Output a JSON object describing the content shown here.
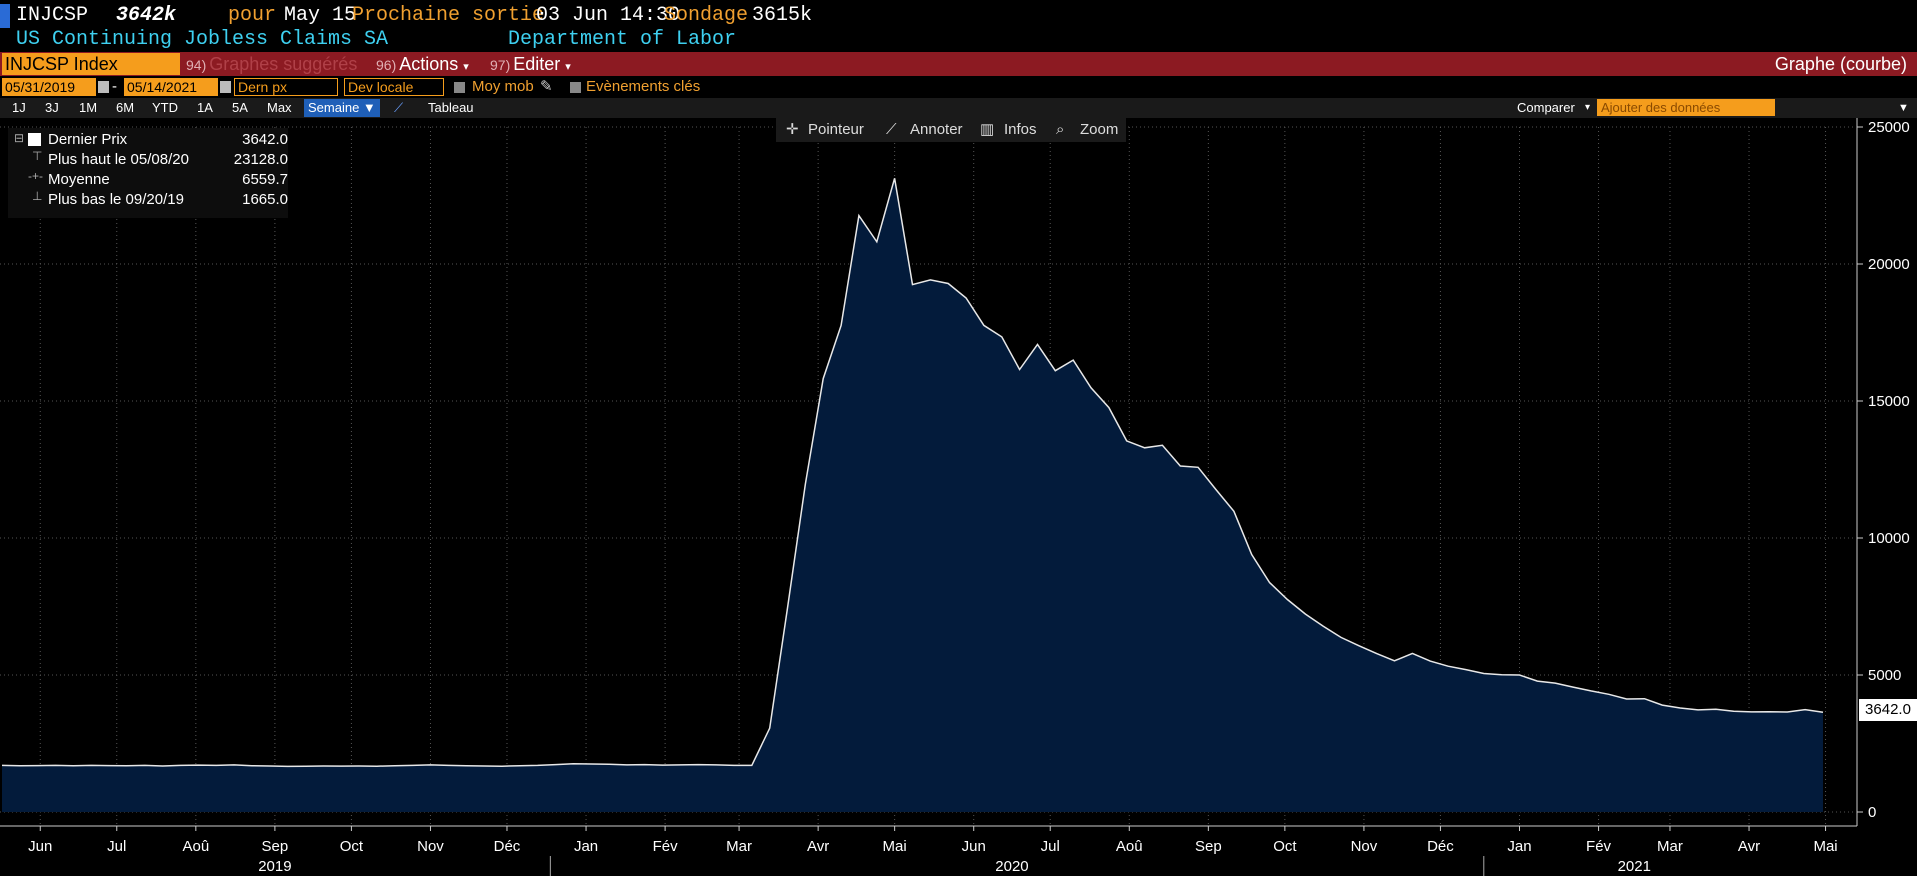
{
  "header": {
    "ticker": "INJCSP",
    "last_value": "3642k",
    "period_label": "pour",
    "period": "May 15",
    "next_release_label": "Prochaine sortie",
    "next_release": "03 Jun 14:30",
    "survey_label": "Sondage",
    "survey": "3615k",
    "description": "US Continuing Jobless Claims SA",
    "source": "Department of Labor"
  },
  "toolbar": {
    "security": "INJCSP Index",
    "suggested": {
      "num": "94)",
      "label": "Graphes suggérés"
    },
    "actions": {
      "num": "96)",
      "label": "Actions"
    },
    "edit": {
      "num": "97)",
      "label": "Editer"
    },
    "graph_type": "Graphe (courbe)"
  },
  "controls": {
    "start_date": "05/31/2019",
    "dash": "-",
    "end_date": "05/14/2021",
    "price_field": "Dern px",
    "currency": "Dev locale",
    "moving_avg": "Moy mob",
    "key_events": "Evènements clés",
    "periods": [
      "1J",
      "3J",
      "1M",
      "6M",
      "YTD",
      "1A",
      "5A",
      "Max"
    ],
    "frequency": "Semaine ▼",
    "table": "Tableau",
    "compare": "Comparer",
    "add_data_placeholder": "Ajouter des données"
  },
  "chart_tools": {
    "pointer": "Pointeur",
    "annotate": "Annoter",
    "info": "Infos",
    "zoom": "Zoom"
  },
  "legend": {
    "last": {
      "label": "Dernier Prix",
      "value": "3642.0"
    },
    "high": {
      "label": "Plus haut le 05/08/20",
      "value": "23128.0"
    },
    "avg": {
      "label": "Moyenne",
      "value": "6559.7"
    },
    "low": {
      "label": "Plus bas le 09/20/19",
      "value": "1665.0"
    }
  },
  "colors": {
    "fill": "#031b3b",
    "line": "#e8e8e8",
    "accent": "#f59d1c",
    "bar": "#8c1a22"
  },
  "chart_data": {
    "type": "area",
    "title": "",
    "xlabel": "",
    "ylabel": "",
    "ylim": [
      0,
      25000
    ],
    "yticks": [
      0,
      5000,
      10000,
      15000,
      20000,
      25000
    ],
    "ytick_labels": [
      "0",
      "5000",
      "10000",
      "15000",
      "20000",
      "25000"
    ],
    "month_ticks": [
      {
        "label": "Jun",
        "date": "2019-06-15"
      },
      {
        "label": "Jul",
        "date": "2019-07-15"
      },
      {
        "label": "Aoû",
        "date": "2019-08-15"
      },
      {
        "label": "Sep",
        "date": "2019-09-15"
      },
      {
        "label": "Oct",
        "date": "2019-10-15"
      },
      {
        "label": "Nov",
        "date": "2019-11-15"
      },
      {
        "label": "Déc",
        "date": "2019-12-15"
      },
      {
        "label": "Jan",
        "date": "2020-01-15"
      },
      {
        "label": "Fév",
        "date": "2020-02-15"
      },
      {
        "label": "Mar",
        "date": "2020-03-15"
      },
      {
        "label": "Avr",
        "date": "2020-04-15"
      },
      {
        "label": "Mai",
        "date": "2020-05-15"
      },
      {
        "label": "Jun",
        "date": "2020-06-15"
      },
      {
        "label": "Jul",
        "date": "2020-07-15"
      },
      {
        "label": "Aoû",
        "date": "2020-08-15"
      },
      {
        "label": "Sep",
        "date": "2020-09-15"
      },
      {
        "label": "Oct",
        "date": "2020-10-15"
      },
      {
        "label": "Nov",
        "date": "2020-11-15"
      },
      {
        "label": "Déc",
        "date": "2020-12-15"
      },
      {
        "label": "Jan",
        "date": "2021-01-15"
      },
      {
        "label": "Fév",
        "date": "2021-02-15"
      },
      {
        "label": "Mar",
        "date": "2021-03-15"
      },
      {
        "label": "Avr",
        "date": "2021-04-15"
      },
      {
        "label": "Mai",
        "date": "2021-05-15"
      }
    ],
    "year_ticks": [
      {
        "label": "2019",
        "date": "2019-09-15"
      },
      {
        "label": "2020",
        "date": "2020-06-30"
      },
      {
        "label": "2021",
        "date": "2021-03-01"
      }
    ],
    "year_boundaries": [
      "2020-01-01",
      "2021-01-01"
    ],
    "last_value_label": "3642.0",
    "series": [
      {
        "x": [
          "2019-05-31",
          "2019-06-07",
          "2019-06-14",
          "2019-06-21",
          "2019-06-28",
          "2019-07-05",
          "2019-07-12",
          "2019-07-19",
          "2019-07-26",
          "2019-08-02",
          "2019-08-09",
          "2019-08-16",
          "2019-08-23",
          "2019-08-30",
          "2019-09-06",
          "2019-09-13",
          "2019-09-20",
          "2019-09-27",
          "2019-10-04",
          "2019-10-11",
          "2019-10-18",
          "2019-10-25",
          "2019-11-01",
          "2019-11-08",
          "2019-11-15",
          "2019-11-22",
          "2019-11-29",
          "2019-12-06",
          "2019-12-13",
          "2019-12-20",
          "2019-12-27",
          "2020-01-03",
          "2020-01-10",
          "2020-01-17",
          "2020-01-24",
          "2020-01-31",
          "2020-02-07",
          "2020-02-14",
          "2020-02-21",
          "2020-02-28",
          "2020-03-06",
          "2020-03-13",
          "2020-03-20",
          "2020-03-27",
          "2020-04-03",
          "2020-04-10",
          "2020-04-17",
          "2020-04-24",
          "2020-05-01",
          "2020-05-08",
          "2020-05-15",
          "2020-05-22",
          "2020-05-29",
          "2020-06-05",
          "2020-06-12",
          "2020-06-19",
          "2020-06-26",
          "2020-07-03",
          "2020-07-10",
          "2020-07-17",
          "2020-07-24",
          "2020-07-31",
          "2020-08-07",
          "2020-08-14",
          "2020-08-21",
          "2020-08-28",
          "2020-09-04",
          "2020-09-11",
          "2020-09-18",
          "2020-09-25",
          "2020-10-02",
          "2020-10-09",
          "2020-10-16",
          "2020-10-23",
          "2020-10-30",
          "2020-11-06",
          "2020-11-13",
          "2020-11-20",
          "2020-11-27",
          "2020-12-04",
          "2020-12-11",
          "2020-12-18",
          "2020-12-25",
          "2021-01-01",
          "2021-01-08",
          "2021-01-15",
          "2021-01-22",
          "2021-01-29",
          "2021-02-05",
          "2021-02-12",
          "2021-02-19",
          "2021-02-26",
          "2021-03-05",
          "2021-03-12",
          "2021-03-19",
          "2021-03-26",
          "2021-04-02",
          "2021-04-09",
          "2021-04-16",
          "2021-04-23",
          "2021-04-30",
          "2021-05-07",
          "2021-05-14"
        ],
        "values": [
          1700,
          1690,
          1695,
          1700,
          1690,
          1700,
          1695,
          1690,
          1700,
          1680,
          1700,
          1710,
          1700,
          1720,
          1690,
          1680,
          1665,
          1670,
          1680,
          1675,
          1680,
          1670,
          1690,
          1700,
          1720,
          1700,
          1690,
          1680,
          1670,
          1690,
          1700,
          1730,
          1760,
          1750,
          1740,
          1720,
          1730,
          1710,
          1720,
          1730,
          1720,
          1700,
          1702,
          3059,
          7446,
          11976,
          15819,
          17756,
          21767,
          20812,
          23128,
          19248,
          19420,
          19290,
          18760,
          17760,
          17338,
          16151,
          17064,
          16107,
          16491,
          15480,
          14758,
          13544,
          13292,
          13385,
          12628,
          12580,
          11767,
          10976,
          9397,
          8373,
          7756,
          7226,
          6786,
          6372,
          6071,
          5781,
          5520,
          5789,
          5508,
          5322,
          5198,
          5054,
          5011,
          4999,
          4778,
          4706,
          4558,
          4419,
          4295,
          4124,
          4134,
          3903,
          3794,
          3727,
          3751,
          3674,
          3653,
          3660,
          3649,
          3738,
          3642
        ]
      }
    ]
  }
}
